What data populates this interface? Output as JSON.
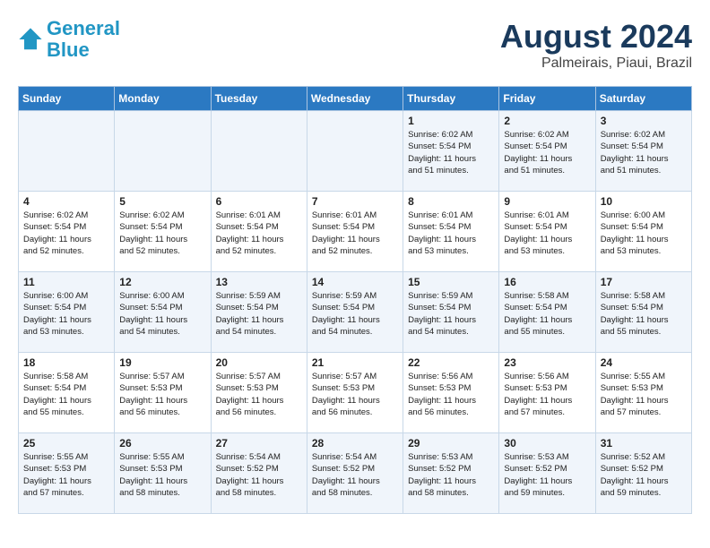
{
  "header": {
    "logo_line1": "General",
    "logo_line2": "Blue",
    "month_title": "August 2024",
    "subtitle": "Palmeirais, Piaui, Brazil"
  },
  "days_of_week": [
    "Sunday",
    "Monday",
    "Tuesday",
    "Wednesday",
    "Thursday",
    "Friday",
    "Saturday"
  ],
  "weeks": [
    [
      {
        "day": "",
        "info": ""
      },
      {
        "day": "",
        "info": ""
      },
      {
        "day": "",
        "info": ""
      },
      {
        "day": "",
        "info": ""
      },
      {
        "day": "1",
        "info": "Sunrise: 6:02 AM\nSunset: 5:54 PM\nDaylight: 11 hours\nand 51 minutes."
      },
      {
        "day": "2",
        "info": "Sunrise: 6:02 AM\nSunset: 5:54 PM\nDaylight: 11 hours\nand 51 minutes."
      },
      {
        "day": "3",
        "info": "Sunrise: 6:02 AM\nSunset: 5:54 PM\nDaylight: 11 hours\nand 51 minutes."
      }
    ],
    [
      {
        "day": "4",
        "info": "Sunrise: 6:02 AM\nSunset: 5:54 PM\nDaylight: 11 hours\nand 52 minutes."
      },
      {
        "day": "5",
        "info": "Sunrise: 6:02 AM\nSunset: 5:54 PM\nDaylight: 11 hours\nand 52 minutes."
      },
      {
        "day": "6",
        "info": "Sunrise: 6:01 AM\nSunset: 5:54 PM\nDaylight: 11 hours\nand 52 minutes."
      },
      {
        "day": "7",
        "info": "Sunrise: 6:01 AM\nSunset: 5:54 PM\nDaylight: 11 hours\nand 52 minutes."
      },
      {
        "day": "8",
        "info": "Sunrise: 6:01 AM\nSunset: 5:54 PM\nDaylight: 11 hours\nand 53 minutes."
      },
      {
        "day": "9",
        "info": "Sunrise: 6:01 AM\nSunset: 5:54 PM\nDaylight: 11 hours\nand 53 minutes."
      },
      {
        "day": "10",
        "info": "Sunrise: 6:00 AM\nSunset: 5:54 PM\nDaylight: 11 hours\nand 53 minutes."
      }
    ],
    [
      {
        "day": "11",
        "info": "Sunrise: 6:00 AM\nSunset: 5:54 PM\nDaylight: 11 hours\nand 53 minutes."
      },
      {
        "day": "12",
        "info": "Sunrise: 6:00 AM\nSunset: 5:54 PM\nDaylight: 11 hours\nand 54 minutes."
      },
      {
        "day": "13",
        "info": "Sunrise: 5:59 AM\nSunset: 5:54 PM\nDaylight: 11 hours\nand 54 minutes."
      },
      {
        "day": "14",
        "info": "Sunrise: 5:59 AM\nSunset: 5:54 PM\nDaylight: 11 hours\nand 54 minutes."
      },
      {
        "day": "15",
        "info": "Sunrise: 5:59 AM\nSunset: 5:54 PM\nDaylight: 11 hours\nand 54 minutes."
      },
      {
        "day": "16",
        "info": "Sunrise: 5:58 AM\nSunset: 5:54 PM\nDaylight: 11 hours\nand 55 minutes."
      },
      {
        "day": "17",
        "info": "Sunrise: 5:58 AM\nSunset: 5:54 PM\nDaylight: 11 hours\nand 55 minutes."
      }
    ],
    [
      {
        "day": "18",
        "info": "Sunrise: 5:58 AM\nSunset: 5:54 PM\nDaylight: 11 hours\nand 55 minutes."
      },
      {
        "day": "19",
        "info": "Sunrise: 5:57 AM\nSunset: 5:53 PM\nDaylight: 11 hours\nand 56 minutes."
      },
      {
        "day": "20",
        "info": "Sunrise: 5:57 AM\nSunset: 5:53 PM\nDaylight: 11 hours\nand 56 minutes."
      },
      {
        "day": "21",
        "info": "Sunrise: 5:57 AM\nSunset: 5:53 PM\nDaylight: 11 hours\nand 56 minutes."
      },
      {
        "day": "22",
        "info": "Sunrise: 5:56 AM\nSunset: 5:53 PM\nDaylight: 11 hours\nand 56 minutes."
      },
      {
        "day": "23",
        "info": "Sunrise: 5:56 AM\nSunset: 5:53 PM\nDaylight: 11 hours\nand 57 minutes."
      },
      {
        "day": "24",
        "info": "Sunrise: 5:55 AM\nSunset: 5:53 PM\nDaylight: 11 hours\nand 57 minutes."
      }
    ],
    [
      {
        "day": "25",
        "info": "Sunrise: 5:55 AM\nSunset: 5:53 PM\nDaylight: 11 hours\nand 57 minutes."
      },
      {
        "day": "26",
        "info": "Sunrise: 5:55 AM\nSunset: 5:53 PM\nDaylight: 11 hours\nand 58 minutes."
      },
      {
        "day": "27",
        "info": "Sunrise: 5:54 AM\nSunset: 5:52 PM\nDaylight: 11 hours\nand 58 minutes."
      },
      {
        "day": "28",
        "info": "Sunrise: 5:54 AM\nSunset: 5:52 PM\nDaylight: 11 hours\nand 58 minutes."
      },
      {
        "day": "29",
        "info": "Sunrise: 5:53 AM\nSunset: 5:52 PM\nDaylight: 11 hours\nand 58 minutes."
      },
      {
        "day": "30",
        "info": "Sunrise: 5:53 AM\nSunset: 5:52 PM\nDaylight: 11 hours\nand 59 minutes."
      },
      {
        "day": "31",
        "info": "Sunrise: 5:52 AM\nSunset: 5:52 PM\nDaylight: 11 hours\nand 59 minutes."
      }
    ]
  ]
}
